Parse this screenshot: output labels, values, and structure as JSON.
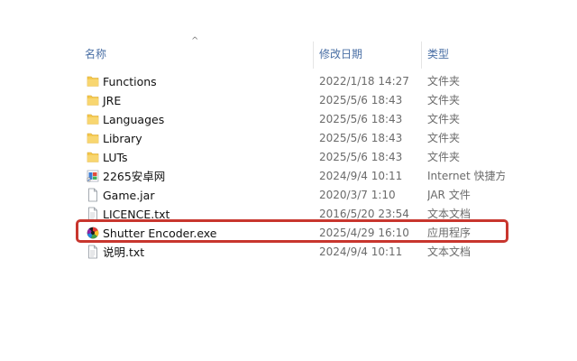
{
  "columns": {
    "name": "名称",
    "date": "修改日期",
    "type": "类型"
  },
  "sort_indicator": "^",
  "files": [
    {
      "name": "Functions",
      "date": "2022/1/18 14:27",
      "type": "文件夹",
      "icon": "folder-icon"
    },
    {
      "name": "JRE",
      "date": "2025/5/6 18:43",
      "type": "文件夹",
      "icon": "folder-icon"
    },
    {
      "name": "Languages",
      "date": "2025/5/6 18:43",
      "type": "文件夹",
      "icon": "folder-icon"
    },
    {
      "name": "Library",
      "date": "2025/5/6 18:43",
      "type": "文件夹",
      "icon": "folder-icon"
    },
    {
      "name": "LUTs",
      "date": "2025/5/6 18:43",
      "type": "文件夹",
      "icon": "folder-icon"
    },
    {
      "name": "2265安卓网",
      "date": "2024/9/4 10:11",
      "type": "Internet 快捷方式",
      "icon": "internet-shortcut-icon"
    },
    {
      "name": "Game.jar",
      "date": "2020/3/7 1:10",
      "type": "JAR 文件",
      "icon": "document-icon"
    },
    {
      "name": "LICENCE.txt",
      "date": "2016/5/20 23:54",
      "type": "文本文档",
      "icon": "text-file-icon"
    },
    {
      "name": "Shutter Encoder.exe",
      "date": "2025/4/29 16:10",
      "type": "应用程序",
      "icon": "app-icon"
    },
    {
      "name": "说明.txt",
      "date": "2024/9/4 10:11",
      "type": "文本文档",
      "icon": "text-file-icon"
    }
  ],
  "colors": {
    "header_text": "#4a6fa5",
    "folder": "#f5c94e",
    "highlight": "#c8362e"
  }
}
